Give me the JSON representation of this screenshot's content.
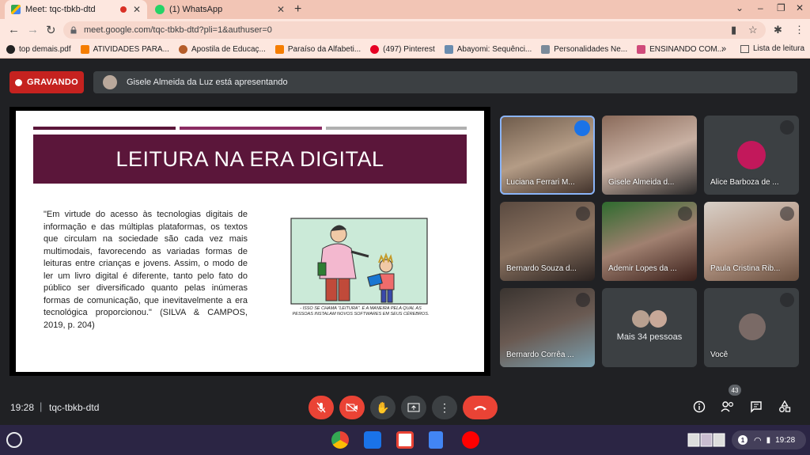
{
  "browser": {
    "tabs": [
      {
        "title": "Meet: tqc-tbkb-dtd",
        "active": true
      },
      {
        "title": "(1) WhatsApp",
        "active": false
      }
    ],
    "url": "meet.google.com/tqc-tbkb-dtd?pli=1&authuser=0",
    "bookmarks": [
      {
        "label": "top demais.pdf",
        "icon": "github-icon"
      },
      {
        "label": "ATIVIDADES PARA...",
        "icon": "blogger-icon"
      },
      {
        "label": "Apostila de Educaç...",
        "icon": "owl-icon"
      },
      {
        "label": "Paraíso da Alfabeti...",
        "icon": "blogger-icon"
      },
      {
        "label": "(497) Pinterest",
        "icon": "pinterest-icon"
      },
      {
        "label": "Abayomi: Sequênci...",
        "icon": "site-icon"
      },
      {
        "label": "Personalidades Ne...",
        "icon": "site-icon"
      },
      {
        "label": "ENSINANDO COM...",
        "icon": "pencil-icon"
      }
    ],
    "bookmarks_more": "»",
    "reading_list": "Lista de leitura"
  },
  "meet": {
    "recording_label": "GRAVANDO",
    "presenter_text": "Gisele Almeida da Luz está apresentando",
    "slide": {
      "title": "LEITURA NA ERA DIGITAL",
      "quote": "\"Em virtude do acesso às tecnologias digitais de informação e das múltiplas plataformas, os textos que circulam na sociedade são cada vez mais multimodais, favorecendo as variadas formas de leituras entre crianças e jovens. Assim, o modo de ler um livro digital é diferente, tanto pelo fato do público ser diversificado quanto pelas inúmeras formas de comunicação, que inevitavelmente a era tecnológica proporcionou.\" (SILVA & CAMPOS, 2019, p. 204)",
      "cartoon_caption": "- ISSO SE CHAMA \"LEITURA\". É A MANEIRA PELA QUAL AS PESSOAS INSTALAM NOVOS SOFTWARES EM SEUS CÉREBROS.",
      "colors": {
        "band": "#5b163a",
        "bar1": "#5b163a",
        "bar2": "#8a2b62",
        "bar3": "#b0b0b0"
      }
    },
    "participants": [
      {
        "name": "Luciana Ferrari M...",
        "state": "speaking"
      },
      {
        "name": "Gisele Almeida d...",
        "state": "video"
      },
      {
        "name": "Alice Barboza de ...",
        "state": "muted"
      },
      {
        "name": "Bernardo Souza d...",
        "state": "muted"
      },
      {
        "name": "Ademir Lopes da ...",
        "state": "muted"
      },
      {
        "name": "Paula Cristina Rib...",
        "state": "muted"
      },
      {
        "name": "Bernardo Corrêa ...",
        "state": "muted"
      },
      {
        "name": "Mais 34 pessoas",
        "state": "others"
      },
      {
        "name": "Você",
        "state": "muted"
      }
    ],
    "time": "19:28",
    "meeting_code": "tqc-tbkb-dtd",
    "people_count": "43"
  },
  "shelf": {
    "tray_time": "19:28",
    "notification_count": "1"
  }
}
